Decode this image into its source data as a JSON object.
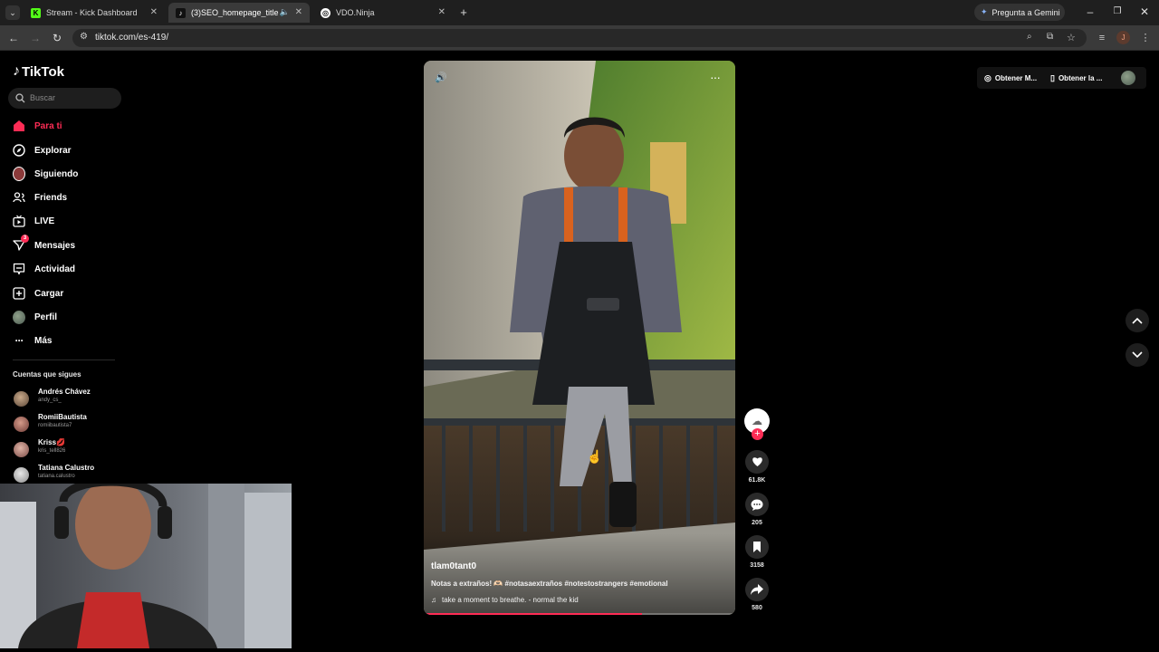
{
  "browser": {
    "tabs": [
      {
        "label": "Stream - Kick Dashboard",
        "favicon": "kick-icon",
        "active": false
      },
      {
        "label": "(3)SEO_homepage_title",
        "favicon": "tiktok-icon",
        "active": true
      },
      {
        "label": "VDO.Ninja",
        "favicon": "vdo-ninja-icon",
        "active": false
      }
    ],
    "new_tab": "+",
    "gemini_label": "Pregunta a Gemini",
    "url": "tiktok.com/es-419/",
    "profile_initial": "J"
  },
  "tiktok": {
    "logo_text": "TikTok",
    "search_placeholder": "Buscar",
    "nav": [
      {
        "label": "Para ti",
        "icon": "home-icon",
        "active": true
      },
      {
        "label": "Explorar",
        "icon": "compass-icon"
      },
      {
        "label": "Siguiendo",
        "icon": "following-avatar-icon"
      },
      {
        "label": "Friends",
        "icon": "friends-icon"
      },
      {
        "label": "LIVE",
        "icon": "live-icon"
      },
      {
        "label": "Mensajes",
        "icon": "messages-icon",
        "badge": "3"
      },
      {
        "label": "Actividad",
        "icon": "activity-icon"
      },
      {
        "label": "Cargar",
        "icon": "upload-icon"
      },
      {
        "label": "Perfil",
        "icon": "profile-avatar-icon"
      },
      {
        "label": "Más",
        "icon": "more-icon"
      }
    ],
    "following_title": "Cuentas que sigues",
    "accounts": [
      {
        "name": "Andrés Chávez",
        "handle": "andy_cs_"
      },
      {
        "name": "RomiiBautista",
        "handle": "romiibautista7"
      },
      {
        "name": "Kriss💋",
        "handle": "kris_tell826"
      },
      {
        "name": "Tatiana Calustro",
        "handle": "tatiana.calustro"
      }
    ],
    "top_right": {
      "get_app_1": "Obtener M...",
      "get_app_2": "Obtener la ..."
    },
    "video": {
      "creator": "tlam0tant0",
      "caption": "Notas a extraños! 🫶🏻 #notasaextraños #notestostrangers #emotional",
      "music": "take a moment to breathe. - normal the kid",
      "progress": 0.7
    },
    "actions": {
      "likes": "61.8K",
      "comments": "205",
      "saves": "3158",
      "shares": "580"
    },
    "colors": {
      "accent": "#fe2c55",
      "background": "#000000"
    }
  }
}
